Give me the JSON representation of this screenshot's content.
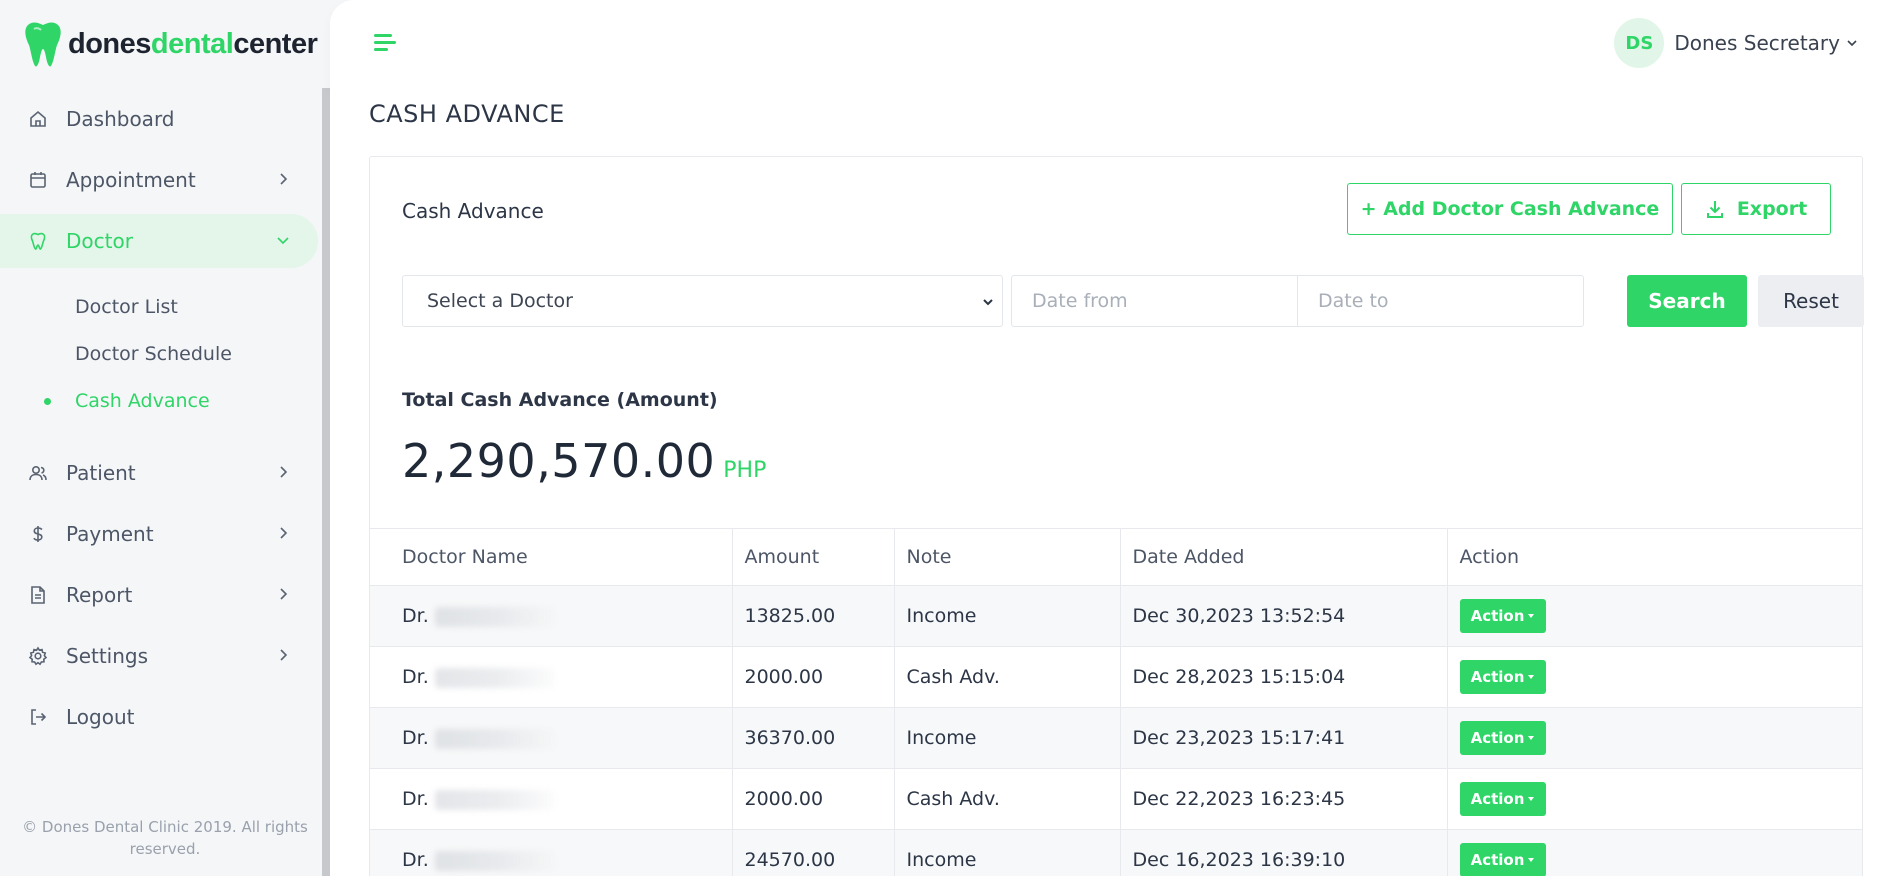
{
  "brand": {
    "part1": "dones",
    "part2": "dental",
    "part3": "center"
  },
  "sidebar": {
    "items": [
      {
        "label": "Dashboard",
        "icon": "home-icon"
      },
      {
        "label": "Appointment",
        "icon": "calendar-icon"
      },
      {
        "label": "Doctor",
        "icon": "tooth-icon",
        "active": true
      },
      {
        "label": "Patient",
        "icon": "users-icon"
      },
      {
        "label": "Payment",
        "icon": "dollar-icon"
      },
      {
        "label": "Report",
        "icon": "document-icon"
      },
      {
        "label": "Settings",
        "icon": "gear-icon"
      },
      {
        "label": "Logout",
        "icon": "logout-icon"
      }
    ],
    "doctor_sub": [
      {
        "label": "Doctor List"
      },
      {
        "label": "Doctor Schedule"
      },
      {
        "label": "Cash Advance",
        "active": true
      }
    ],
    "copyright": "© Dones Dental Clinic 2019. All rights reserved."
  },
  "header": {
    "avatar_initials": "DS",
    "username": "Dones Secretary"
  },
  "page": {
    "title": "CASH ADVANCE",
    "card_title": "Cash Advance",
    "add_button": "+ Add Doctor Cash Advance",
    "export_button": "Export",
    "filter": {
      "doctor_select": "Select a Doctor",
      "date_from_placeholder": "Date from",
      "date_to_placeholder": "Date to",
      "search_button": "Search",
      "reset_button": "Reset"
    },
    "total": {
      "label": "Total Cash Advance (Amount)",
      "amount": "2,290,570.00",
      "currency": "PHP"
    }
  },
  "table": {
    "columns": [
      "Doctor Name",
      "Amount",
      "Note",
      "Date Added",
      "Action"
    ],
    "rows": [
      {
        "doctor_prefix": "Dr.",
        "amount": "13825.00",
        "note": "Income",
        "date": "Dec 30,2023 13:52:54",
        "action": "Action"
      },
      {
        "doctor_prefix": "Dr.",
        "amount": "2000.00",
        "note": "Cash Adv.",
        "date": "Dec 28,2023 15:15:04",
        "action": "Action"
      },
      {
        "doctor_prefix": "Dr.",
        "amount": "36370.00",
        "note": "Income",
        "date": "Dec 23,2023 15:17:41",
        "action": "Action"
      },
      {
        "doctor_prefix": "Dr.",
        "amount": "2000.00",
        "note": "Cash Adv.",
        "date": "Dec 22,2023 16:23:45",
        "action": "Action"
      },
      {
        "doctor_prefix": "Dr.",
        "amount": "24570.00",
        "note": "Income",
        "date": "Dec 16,2023 16:39:10",
        "action": "Action"
      }
    ]
  },
  "colors": {
    "accent": "#2fd567",
    "text": "#2c3646",
    "sidebar_bg": "#f5f6f8"
  }
}
